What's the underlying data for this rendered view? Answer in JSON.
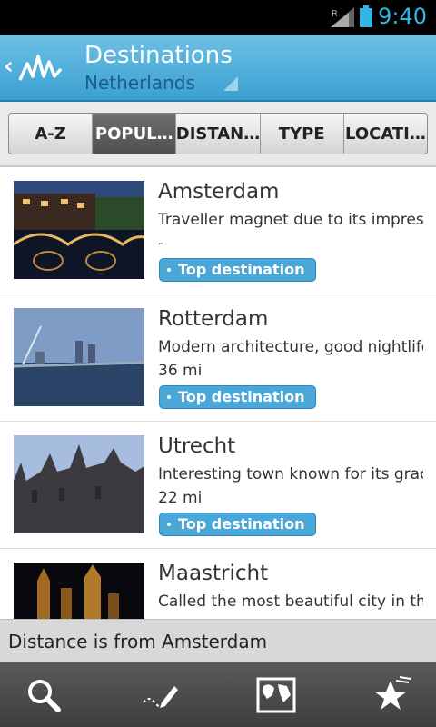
{
  "status_bar": {
    "time": "9:40",
    "network_letter": "R"
  },
  "app_bar": {
    "title": "Destinations",
    "subtitle": "Netherlands"
  },
  "tabs": [
    {
      "label": "A-Z",
      "active": false
    },
    {
      "label": "POPUL…",
      "active": true
    },
    {
      "label": "DISTAN…",
      "active": false
    },
    {
      "label": "TYPE",
      "active": false
    },
    {
      "label": "LOCATI…",
      "active": false
    }
  ],
  "destinations": [
    {
      "name": "Amsterdam",
      "description": "Traveller magnet due to its impres…",
      "distance": "-",
      "badge": "Top destination",
      "image": "amsterdam-canal-night"
    },
    {
      "name": "Rotterdam",
      "description": "Modern architecture, good nightlife…",
      "distance": "36 mi",
      "badge": "Top destination",
      "image": "rotterdam-bridge-skyline"
    },
    {
      "name": "Utrecht",
      "description": "Interesting town known for its grac…",
      "distance": "22 mi",
      "badge": "Top destination",
      "image": "utrecht-cathedral"
    },
    {
      "name": "Maastricht",
      "description": "Called the most beautiful city in the…",
      "distance": "",
      "badge": "",
      "image": "maastricht-night"
    }
  ],
  "footer_note": "Distance is from Amsterdam",
  "bottom_bar": [
    "search-icon",
    "draw-icon",
    "map-icon",
    "favorites-icon"
  ],
  "colors": {
    "accent": "#33b5e5",
    "app_bar": "#4aa8d8",
    "badge": "#4aa8d8"
  }
}
